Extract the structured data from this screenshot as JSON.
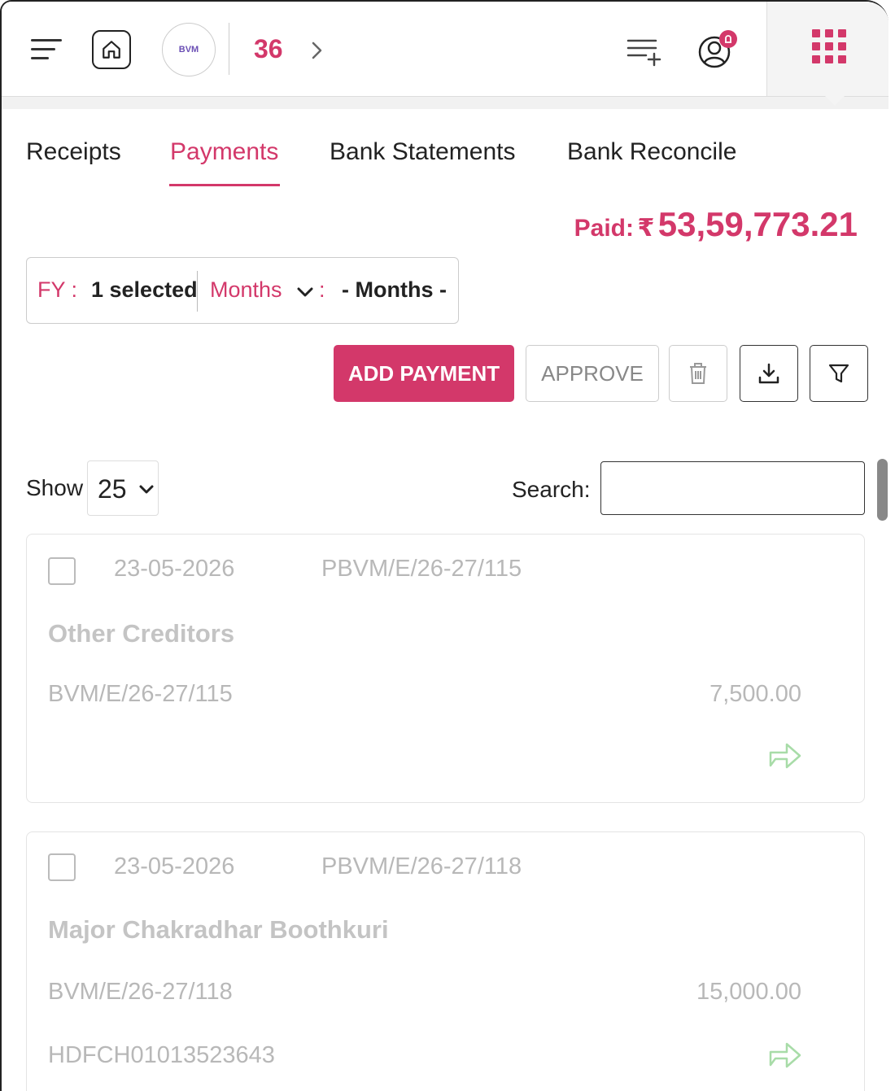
{
  "header": {
    "logo_text": "BVM",
    "count": "36"
  },
  "tabs": [
    {
      "label": "Receipts"
    },
    {
      "label": "Payments"
    },
    {
      "label": "Bank Statements"
    },
    {
      "label": "Bank Reconcile"
    }
  ],
  "summary": {
    "paid_label": "Paid:",
    "currency": "₹",
    "paid_amount": "53,59,773.21"
  },
  "filters": {
    "fy_label": "FY :",
    "fy_value": "1 selected",
    "months_label": "Months",
    "months_colon": ":",
    "months_value": "- Months -"
  },
  "actions": {
    "add_payment": "ADD PAYMENT",
    "approve": "APPROVE"
  },
  "table_controls": {
    "show_label": "Show",
    "page_size": "25",
    "search_label": "Search:",
    "search_value": ""
  },
  "payments": [
    {
      "date": "23-05-2026",
      "pvoucher": "PBVM/E/26-27/115",
      "party": "Other Creditors",
      "voucher": "BVM/E/26-27/115",
      "amount": "7,500.00",
      "ref": ""
    },
    {
      "date": "23-05-2026",
      "pvoucher": "PBVM/E/26-27/118",
      "party": "Major Chakradhar Boothkuri",
      "voucher": "BVM/E/26-27/118",
      "amount": "15,000.00",
      "ref": "HDFCH01013523643"
    }
  ],
  "colors": {
    "accent": "#d3386a",
    "muted_text": "#b8b8b8",
    "arrow_green": "#a8dca8"
  }
}
